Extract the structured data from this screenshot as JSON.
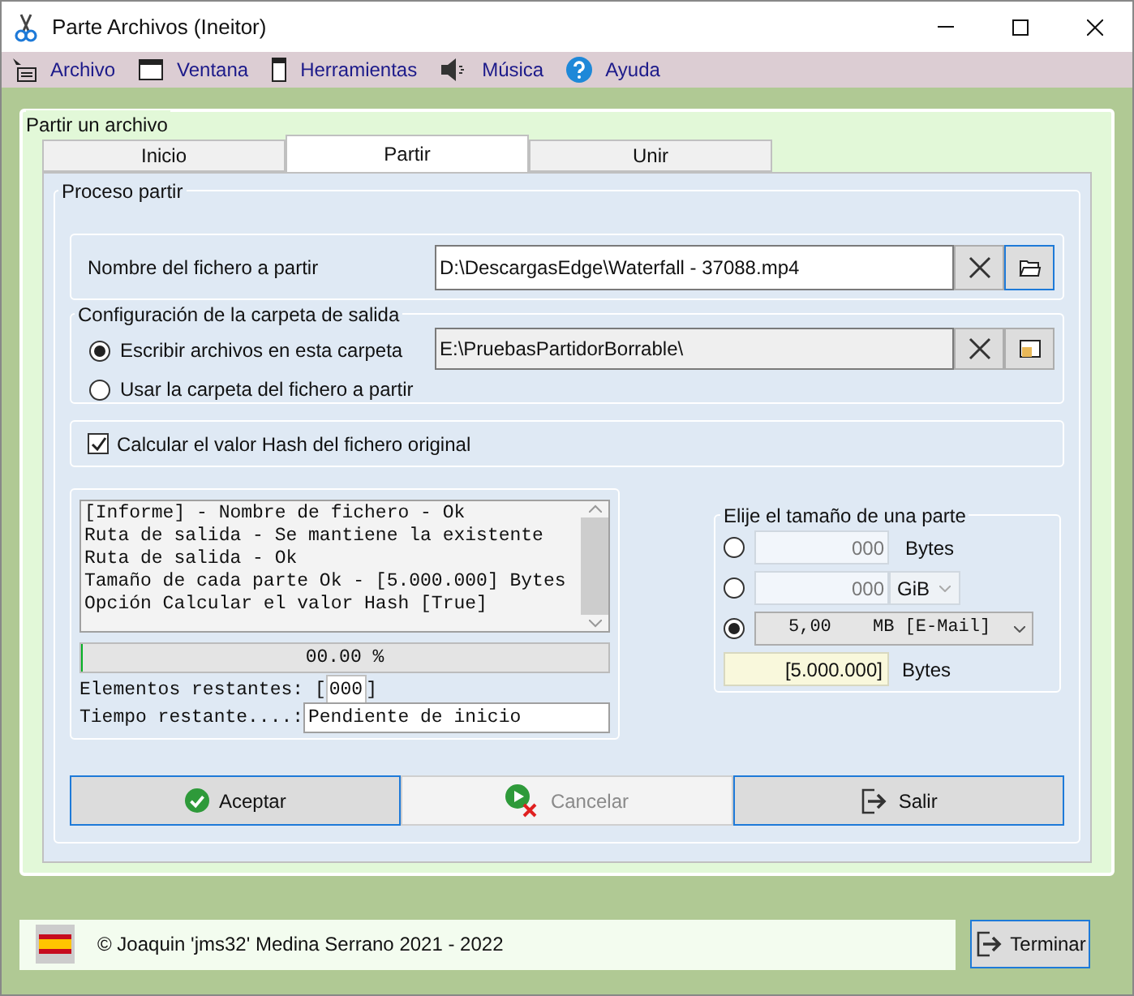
{
  "window": {
    "title": "Parte Archivos (Ineitor)"
  },
  "menu": [
    {
      "label": "Archivo",
      "kind": "list"
    },
    {
      "label": "Ventana",
      "kind": "window"
    },
    {
      "label": "Herramientas",
      "kind": "device"
    },
    {
      "label": "Música",
      "kind": "speaker"
    },
    {
      "label": "Ayuda",
      "kind": "help"
    }
  ],
  "group_title": "Partir un archivo",
  "tabs": [
    {
      "label": "Inicio",
      "selected": false
    },
    {
      "label": "Partir",
      "selected": true
    },
    {
      "label": "Unir",
      "selected": false
    }
  ],
  "section_title": "Proceso partir",
  "source_file": {
    "label": "Nombre del fichero a partir",
    "value": "D:\\DescargasEdge\\Waterfall - 37088.mp4"
  },
  "output_folder": {
    "title": "Configuración de la carpeta de salida",
    "options": [
      {
        "label": "Escribir archivos en esta carpeta",
        "selected": true
      },
      {
        "label": "Usar la carpeta del fichero a partir",
        "selected": false
      }
    ],
    "value": "E:\\PruebasPartidorBorrable\\"
  },
  "hash_option": {
    "label": "Calcular el valor Hash del fichero original",
    "checked": true
  },
  "log": {
    "lines": [
      "[Informe] - Nombre de fichero - Ok",
      "Ruta de salida - Se mantiene la existente",
      "Ruta de salida - Ok",
      "Tamaño de cada parte Ok - [5.000.000] Bytes",
      "Opción Calcular el valor Hash [True]"
    ]
  },
  "progress": {
    "text": "00.00 %",
    "level": 0
  },
  "remaining_items": {
    "label": "Elementos restantes:",
    "open": "[",
    "value": "000",
    "close": "]"
  },
  "remaining_time": {
    "label": "Tiempo restante....:",
    "value": "Pendiente de inicio"
  },
  "part_size": {
    "title": "Elije el tamaño de una parte",
    "rows": [
      {
        "kind": "input",
        "placeholder": "000",
        "unit": "Bytes",
        "selected": false
      },
      {
        "kind": "unit-select",
        "placeholder": "000",
        "unit": "GiB",
        "selected": false
      },
      {
        "kind": "preset",
        "value": "5,00",
        "unit": "MB [E-Mail]",
        "selected": true
      }
    ],
    "result": {
      "value": "[5.000.000]",
      "unit": "Bytes"
    }
  },
  "buttons": [
    {
      "label": "Aceptar",
      "kind": "accept",
      "disabled": false
    },
    {
      "label": "Cancelar",
      "kind": "cancel",
      "disabled": true
    },
    {
      "label": "Salir",
      "kind": "exit",
      "disabled": false
    }
  ],
  "footer": {
    "copyright": "© Joaquin 'jms32' Medina Serrano 2021 - 2022",
    "button": "Terminar"
  }
}
